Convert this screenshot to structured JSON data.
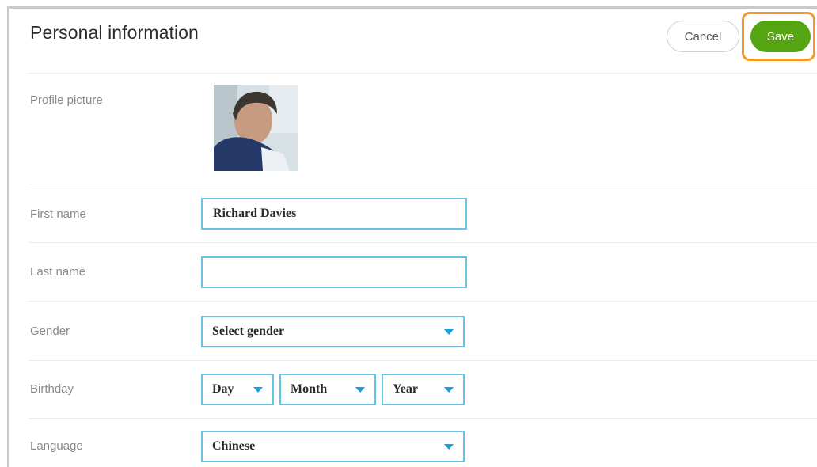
{
  "header": {
    "title": "Personal information",
    "cancel_label": "Cancel",
    "save_label": "Save"
  },
  "fields": {
    "profile_picture": {
      "label": "Profile picture"
    },
    "first_name": {
      "label": "First name",
      "value": "Richard Davies"
    },
    "last_name": {
      "label": "Last name",
      "value": ""
    },
    "gender": {
      "label": "Gender",
      "selected": "Select gender"
    },
    "birthday": {
      "label": "Birthday",
      "day": "Day",
      "month": "Month",
      "year": "Year"
    },
    "language": {
      "label": "Language",
      "selected": "Chinese"
    }
  },
  "colors": {
    "accent_blue": "#66c3e6",
    "save_green": "#55a512",
    "highlight_orange": "#f39a2b"
  }
}
